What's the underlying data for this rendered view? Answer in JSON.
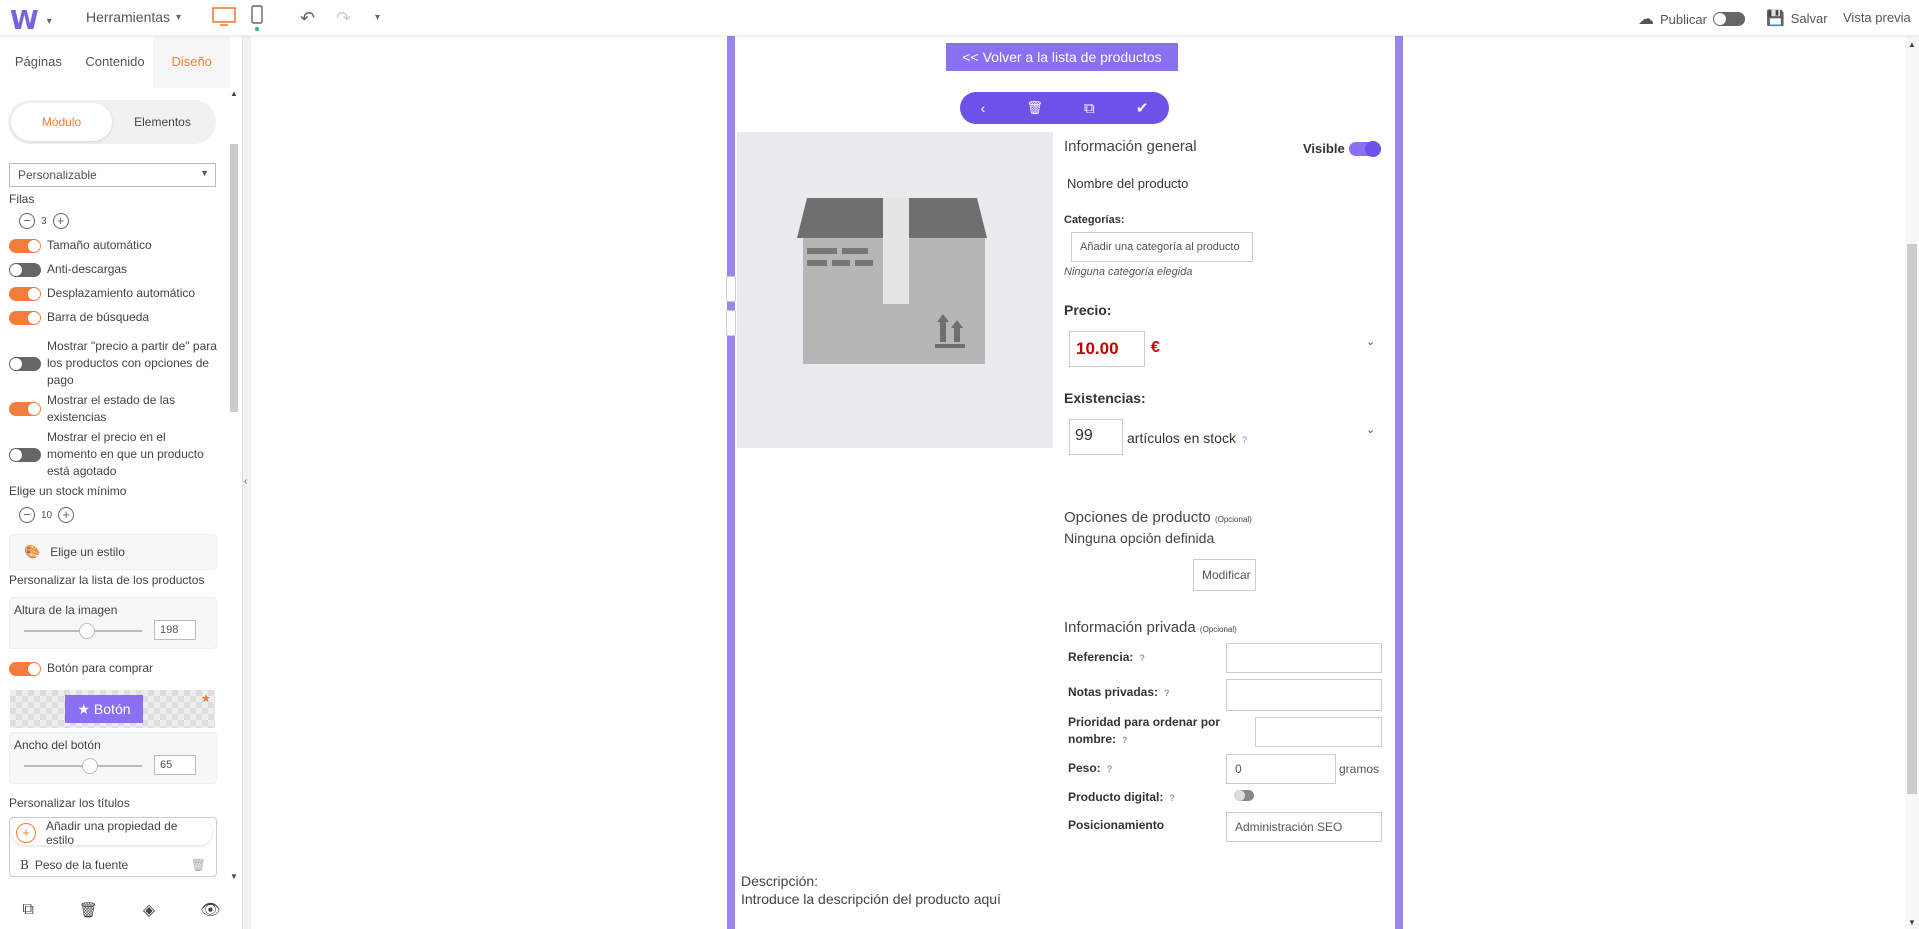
{
  "topbar": {
    "logo": "W",
    "tools_label": "Herramientas",
    "publish_label": "Publicar",
    "save_label": "Salvar",
    "preview_label": "Vista previa"
  },
  "left_panel": {
    "tabs": [
      "Páginas",
      "Contenido",
      "Diseño"
    ],
    "segments": [
      "Módulo",
      "Elementos"
    ],
    "layout_select": "Personalizable",
    "rows_label": "Filas",
    "rows_value": "3",
    "options": [
      {
        "label": "Tamaño automático",
        "on": true
      },
      {
        "label": "Anti-descargas",
        "on": false
      },
      {
        "label": "Desplazamiento automático",
        "on": true
      },
      {
        "label": "Barra de búsqueda",
        "on": true
      },
      {
        "label": "Mostrar \"precio a partir de\" para los productos con opciones de pago",
        "on": false
      },
      {
        "label": "Mostrar el estado de las existencias",
        "on": true
      },
      {
        "label": "Mostrar el precio en el momento en que un producto está agotado",
        "on": false
      }
    ],
    "min_stock_label": "Elige un stock mínimo",
    "min_stock_value": "10",
    "style_button": "Elige un estilo",
    "customize_list_label": "Personalizar la lista de los productos",
    "image_height_label": "Altura de la imagen",
    "image_height_value": "198",
    "buy_button_label": "Botón para comprar",
    "button_preview_text": "★ Botón",
    "button_width_label": "Ancho del botón",
    "button_width_value": "65",
    "customize_titles_label": "Personalizar los títulos",
    "add_style_prop": "Añadir una propiedad de estilo",
    "font_weight_label": "Peso de la fuente"
  },
  "canvas": {
    "back_button": "<< Volver a la lista de productos",
    "general_info": "Información general",
    "visible_label": "Visible",
    "product_name": "Nombre del producto",
    "categories_label": "Categorías:",
    "add_category": "Añadir una categoría al producto",
    "no_category": "Ninguna categoría elegida",
    "price_label": "Precio:",
    "price_value": "10.00",
    "currency": "€",
    "stock_label": "Existencias:",
    "stock_value": "99",
    "stock_unit": "artículos en stock",
    "options_title": "Opciones de producto",
    "optional": "(Opcional)",
    "no_option": "Ninguna opción definida",
    "modify_button": "Modificar",
    "private_info": "Información privada",
    "reference_label": "Referencia:",
    "private_notes_label": "Notas privadas:",
    "priority_label": "Prioridad para ordenar por nombre:",
    "weight_label": "Peso:",
    "weight_value": "0",
    "weight_unit": "gramos",
    "digital_label": "Producto digital:",
    "seo_label": "Posicionamiento",
    "seo_button": "Administración SEO",
    "description_label": "Descripción:",
    "description_placeholder": "Introduce la descripción del producto aquí"
  },
  "colors": {
    "accent": "#f47d3b",
    "purple": "#8c70f2",
    "price_red": "#c00000"
  }
}
